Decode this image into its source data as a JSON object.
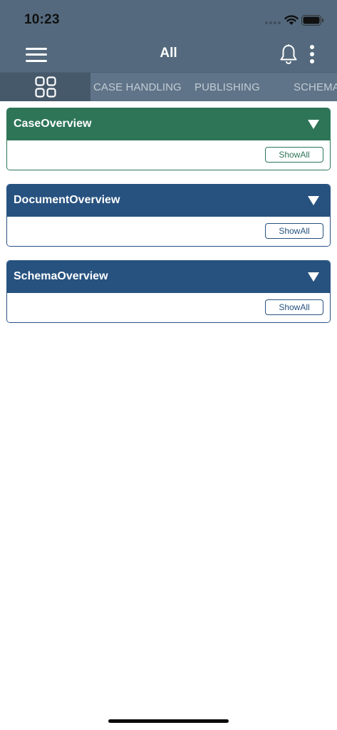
{
  "status_bar": {
    "time": "10:23",
    "icons": [
      "cellular-signal-icon",
      "wifi-icon",
      "battery-icon"
    ]
  },
  "nav": {
    "title": "All",
    "icons": [
      "hamburger-menu-icon",
      "bell-icon",
      "more-vertical-icon"
    ]
  },
  "tabs": {
    "grid_icon": "grid-icon",
    "items": [
      {
        "label": "CASE HANDLING"
      },
      {
        "label": "PUBLISHING"
      },
      {
        "label": "SCHEMA"
      }
    ]
  },
  "cards": [
    {
      "title": "CaseOverview",
      "button": "ShowAll",
      "color": "#2e7558"
    },
    {
      "title": "DocumentOverview",
      "button": "ShowAll",
      "color": "#275280"
    },
    {
      "title": "SchemaOverview",
      "button": "ShowAll",
      "color": "#275280"
    }
  ],
  "colors": {
    "header": "#54697d",
    "tabs_bg": "#5f7488",
    "tab_selected": "#46596b",
    "case_green": "#2e7558",
    "overview_blue": "#275280"
  }
}
